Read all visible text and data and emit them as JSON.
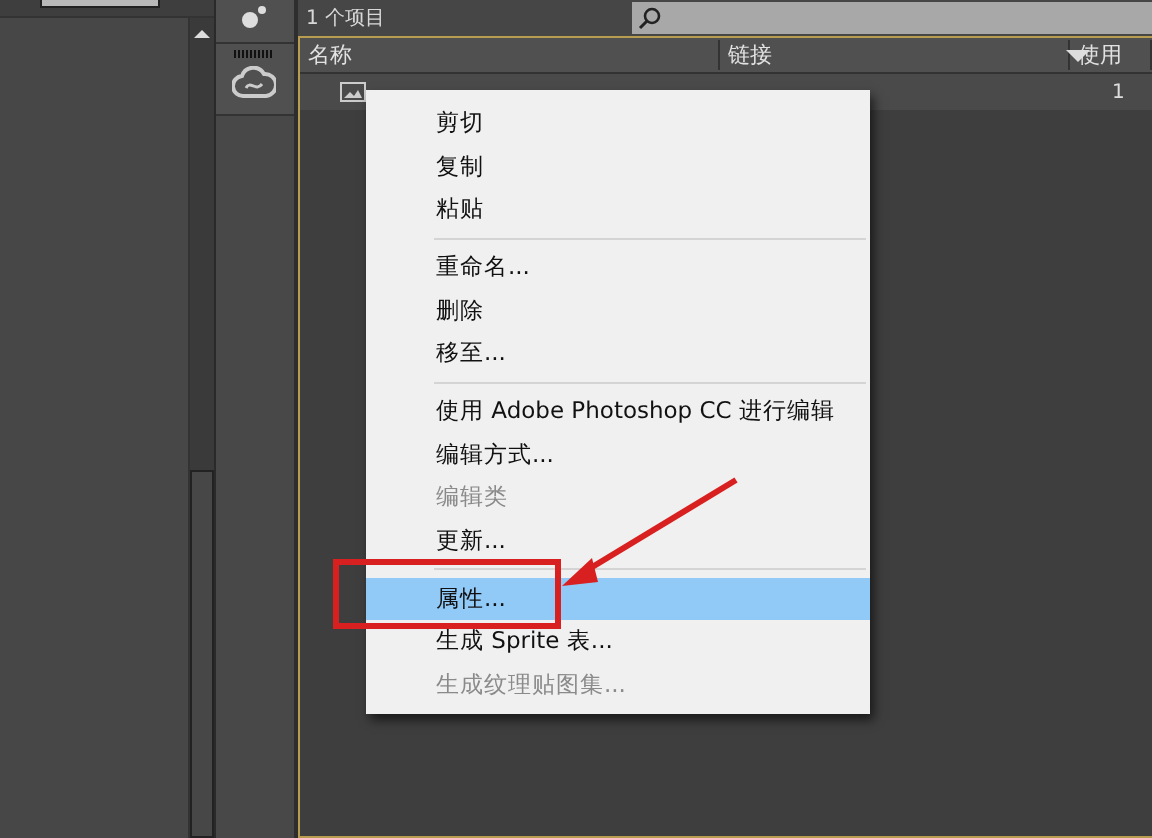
{
  "panel": {
    "item_count": "1 个项目",
    "columns": [
      "名称",
      "链接",
      "使用"
    ],
    "rows": [
      {
        "use_count": "1"
      }
    ]
  },
  "context_menu": {
    "groups": [
      [
        {
          "label": "剪切",
          "disabled": false,
          "selected": false
        },
        {
          "label": "复制",
          "disabled": false,
          "selected": false
        },
        {
          "label": "粘贴",
          "disabled": false,
          "selected": false
        }
      ],
      [
        {
          "label": "重命名...",
          "disabled": false,
          "selected": false
        },
        {
          "label": "删除",
          "disabled": false,
          "selected": false
        },
        {
          "label": "移至...",
          "disabled": false,
          "selected": false
        }
      ],
      [
        {
          "label": "使用 Adobe Photoshop CC 进行编辑",
          "disabled": false,
          "selected": false
        },
        {
          "label": "编辑方式...",
          "disabled": false,
          "selected": false
        },
        {
          "label": "编辑类",
          "disabled": true,
          "selected": false
        },
        {
          "label": "更新...",
          "disabled": false,
          "selected": false
        }
      ],
      [
        {
          "label": "属性...",
          "disabled": false,
          "selected": true
        },
        {
          "label": "生成 Sprite 表...",
          "disabled": false,
          "selected": false
        },
        {
          "label": "生成纹理贴图集...",
          "disabled": true,
          "selected": false
        }
      ]
    ]
  }
}
